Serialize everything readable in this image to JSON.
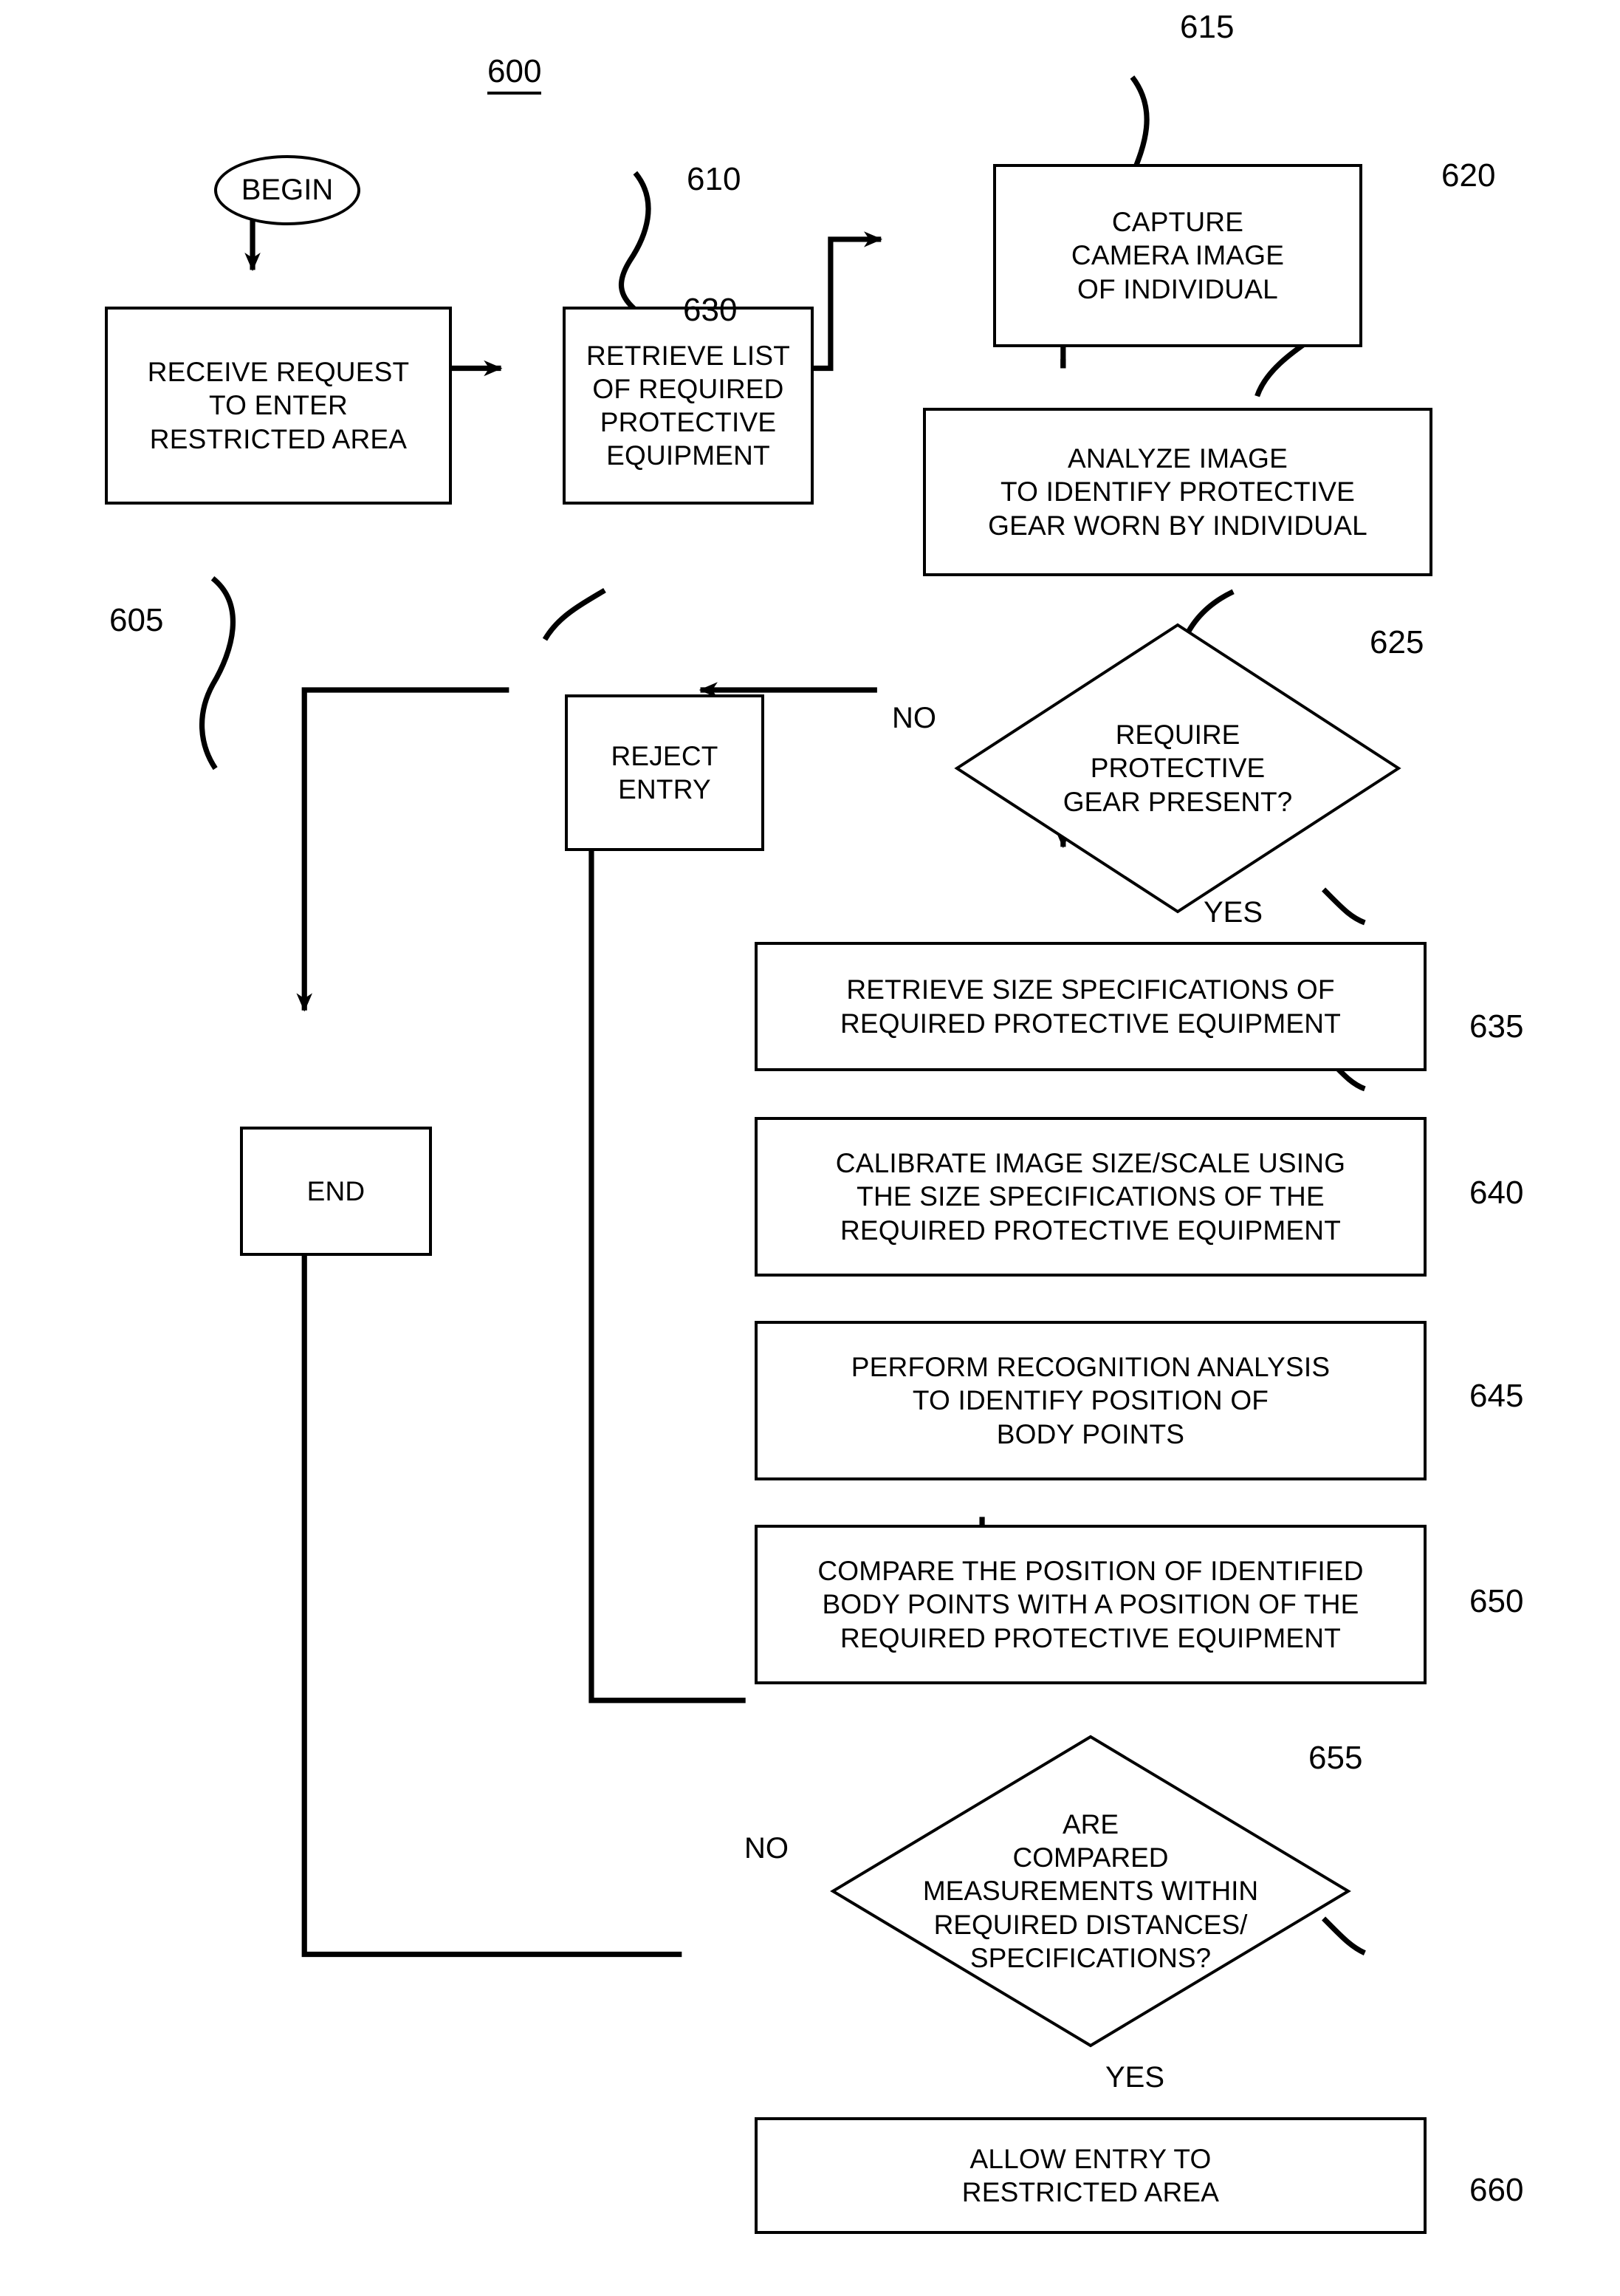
{
  "figure": {
    "number": "600"
  },
  "nodes": {
    "begin": {
      "label": "BEGIN"
    },
    "receive_request": {
      "label": "RECEIVE REQUEST\nTO ENTER\nRESTRICTED AREA",
      "ref": "605"
    },
    "retrieve_list": {
      "label": "RETRIEVE LIST\nOF REQUIRED\nPROTECTIVE\nEQUIPMENT",
      "ref": "610"
    },
    "capture_image": {
      "label": "CAPTURE\nCAMERA IMAGE\nOF INDIVIDUAL",
      "ref": "615"
    },
    "analyze_image": {
      "label": "ANALYZE IMAGE\nTO IDENTIFY PROTECTIVE\nGEAR WORN BY INDIVIDUAL",
      "ref": "620"
    },
    "gear_present_decision": {
      "label": "REQUIRE\nPROTECTIVE\nGEAR PRESENT?",
      "ref": "625"
    },
    "reject_entry": {
      "label": "REJECT\nENTRY",
      "ref": "630"
    },
    "retrieve_size_specs": {
      "label": "RETRIEVE SIZE SPECIFICATIONS OF\nREQUIRED PROTECTIVE EQUIPMENT",
      "ref": "635"
    },
    "calibrate_image": {
      "label": "CALIBRATE IMAGE SIZE/SCALE USING\nTHE SIZE SPECIFICATIONS OF THE\nREQUIRED PROTECTIVE EQUIPMENT",
      "ref": "640"
    },
    "recognition_analysis": {
      "label": "PERFORM RECOGNITION ANALYSIS\nTO IDENTIFY POSITION OF\nBODY POINTS",
      "ref": "645"
    },
    "compare_position": {
      "label": "COMPARE THE POSITION OF IDENTIFIED\nBODY POINTS WITH A POSITION OF THE\nREQUIRED PROTECTIVE EQUIPMENT",
      "ref": "650"
    },
    "measurements_decision": {
      "label": "ARE\nCOMPARED\nMEASUREMENTS WITHIN\nREQUIRED DISTANCES/\nSPECIFICATIONS?",
      "ref": "655"
    },
    "allow_entry": {
      "label": "ALLOW ENTRY TO\nRESTRICTED AREA",
      "ref": "660"
    },
    "end": {
      "label": "END"
    }
  },
  "edge_labels": {
    "gear_no": "NO",
    "gear_yes": "YES",
    "measurements_no": "NO",
    "measurements_yes": "YES"
  }
}
